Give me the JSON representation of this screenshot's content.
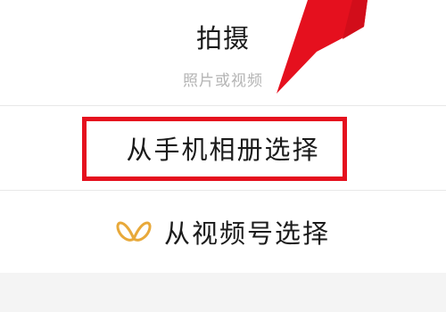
{
  "sheet": {
    "shoot": {
      "title": "拍摄",
      "subtitle": "照片或视频"
    },
    "album": {
      "label": "从手机相册选择"
    },
    "channels": {
      "label": "从视频号选择",
      "icon": "channels-butterfly-icon"
    }
  },
  "colors": {
    "annotation_red": "#e5101e",
    "channels_icon": "#e8a93a",
    "text_primary": "#1b1b1b",
    "text_secondary": "#b4b4b4"
  }
}
